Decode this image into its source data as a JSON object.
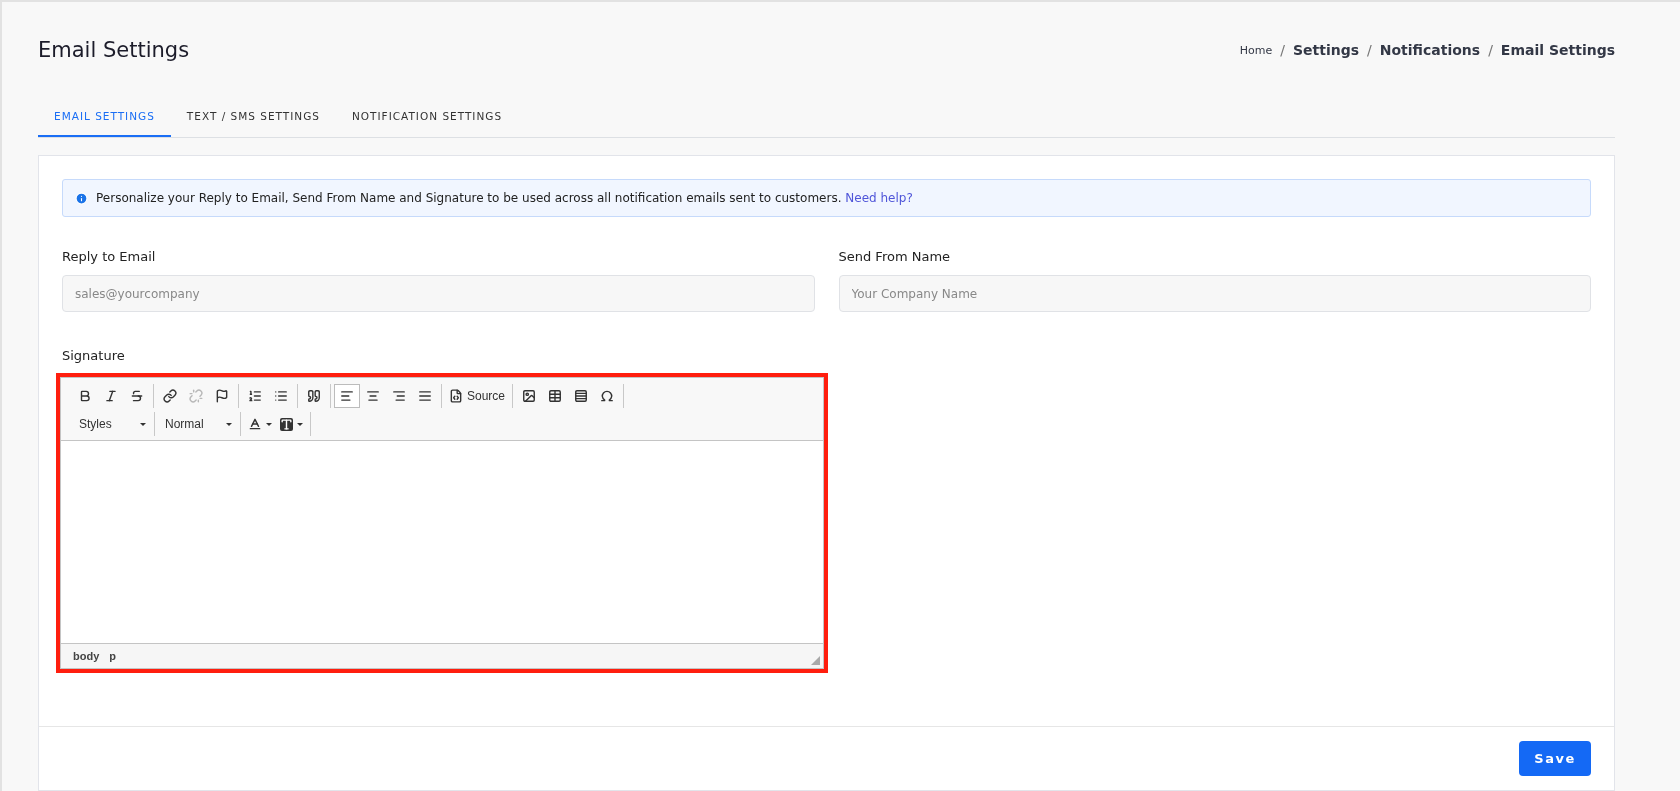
{
  "page_title": "Email Settings",
  "breadcrumb_separator": "/",
  "breadcrumb": [
    {
      "label": "Home",
      "current": false
    },
    {
      "label": "Settings",
      "current": true
    },
    {
      "label": "Notifications",
      "current": true
    },
    {
      "label": "Email Settings",
      "current": true
    }
  ],
  "tabs": [
    {
      "label": "EMAIL SETTINGS",
      "selected": true
    },
    {
      "label": "TEXT / SMS SETTINGS",
      "selected": false
    },
    {
      "label": "NOTIFICATION SETTINGS",
      "selected": false
    }
  ],
  "alert": {
    "text": "Personalize your Reply to Email, Send From Name and Signature to be used across all notification emails sent to customers.",
    "link": "Need help?"
  },
  "fields": [
    {
      "label": "Reply to Email",
      "placeholder": "sales@yourcompany"
    },
    {
      "label": "Send From Name",
      "placeholder": "Your Company Name"
    }
  ],
  "signature": {
    "label": "Signature",
    "highlighted": true,
    "toolbar": [
      [
        {
          "selected": false,
          "disabled": false
        },
        {
          "selected": false,
          "disabled": false
        },
        {
          "selected": false,
          "disabled": false
        }
      ],
      [
        {
          "selected": false,
          "disabled": false
        },
        {
          "selected": false,
          "disabled": true
        },
        {
          "selected": false,
          "disabled": false
        }
      ],
      [
        {
          "selected": false,
          "disabled": false
        },
        {
          "selected": false,
          "disabled": false
        }
      ],
      [
        {
          "selected": false,
          "disabled": false
        }
      ],
      [
        {
          "selected": true,
          "disabled": false
        },
        {
          "selected": false,
          "disabled": false
        },
        {
          "selected": false,
          "disabled": false
        },
        {
          "selected": false,
          "disabled": false
        }
      ],
      [
        {
          "selected": false,
          "disabled": false,
          "label": "Source"
        }
      ],
      [
        {
          "selected": false,
          "disabled": false
        },
        {
          "selected": false,
          "disabled": false
        },
        {
          "selected": false,
          "disabled": false
        },
        {
          "selected": false,
          "disabled": false
        }
      ]
    ],
    "dropdowns": [
      "Styles",
      "Normal"
    ],
    "path": [
      "body",
      "p"
    ]
  },
  "save_button": "Save"
}
